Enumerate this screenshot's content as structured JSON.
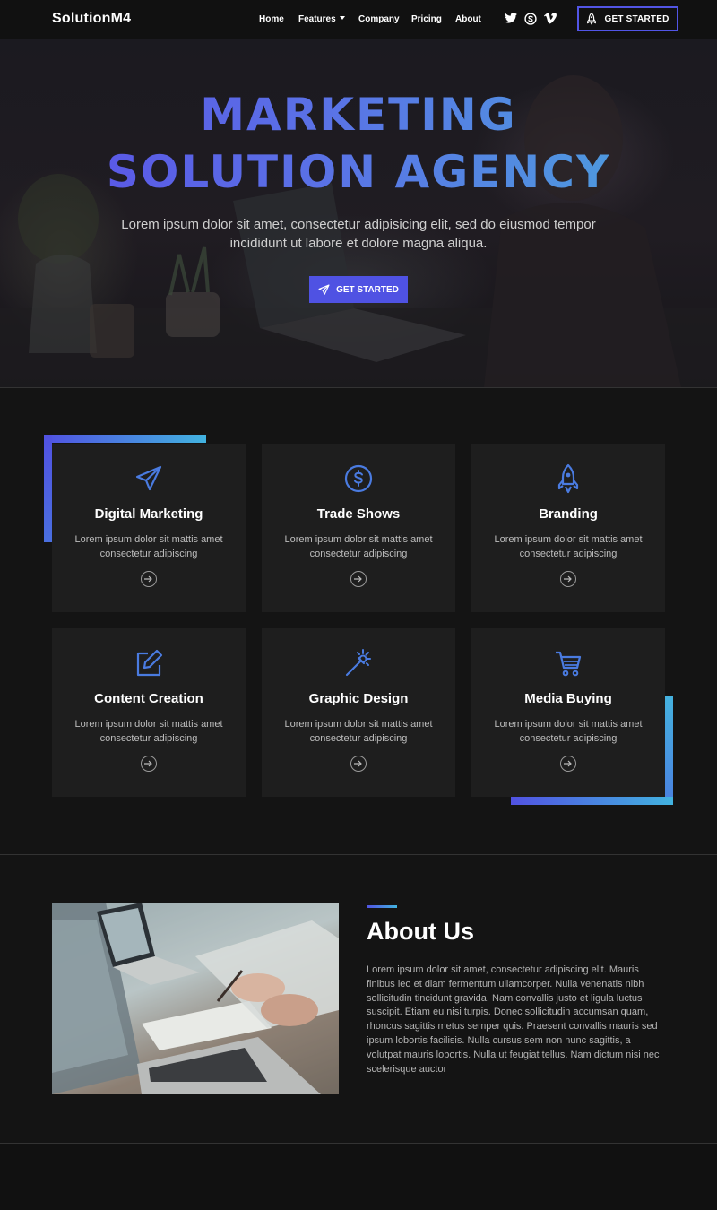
{
  "nav": {
    "logo": "SolutionM4",
    "links": [
      "Home",
      "Features",
      "Company",
      "Pricing",
      "About"
    ],
    "social_icons": [
      "twitter-icon",
      "skype-icon",
      "vimeo-icon"
    ],
    "cta_label": "GET STARTED"
  },
  "hero": {
    "title_line1": "MARKETING",
    "title_line2": "SOLUTION AGENCY",
    "subtitle_line1": "Lorem ipsum dolor sit amet, consectetur adipisicing elit, sed do eiusmod tempor",
    "subtitle_line2": "incididunt ut labore et dolore magna aliqua.",
    "button_label": "GET STARTED"
  },
  "services": {
    "cards": [
      {
        "title": "Digital Marketing",
        "text_line1": "Lorem ipsum dolor sit mattis amet",
        "text_line2": "consectetur adipiscing",
        "icon": "paper-plane-icon"
      },
      {
        "title": "Trade Shows",
        "text_line1": "Lorem ipsum dolor sit mattis amet",
        "text_line2": "consectetur adipiscing",
        "icon": "dollar-circle-icon"
      },
      {
        "title": "Branding",
        "text_line1": "Lorem ipsum dolor sit mattis amet",
        "text_line2": "consectetur adipiscing",
        "icon": "rocket-icon"
      },
      {
        "title": "Content Creation",
        "text_line1": "Lorem ipsum dolor sit mattis amet",
        "text_line2": "consectetur adipiscing",
        "icon": "edit-icon"
      },
      {
        "title": "Graphic Design",
        "text_line1": "Lorem ipsum dolor sit mattis amet",
        "text_line2": "consectetur adipiscing",
        "icon": "magic-wand-icon"
      },
      {
        "title": "Media Buying",
        "text_line1": "Lorem ipsum dolor sit mattis amet",
        "text_line2": "consectetur adipiscing",
        "icon": "shopping-cart-icon"
      }
    ]
  },
  "about": {
    "title": "About Us",
    "body": "Lorem ipsum dolor sit amet, consectetur adipiscing elit. Mauris finibus leo et diam fermentum ullamcorper. Nulla venenatis nibh sollicitudin tincidunt gravida. Nam convallis justo et ligula luctus suscipit. Etiam eu nisi turpis. Donec sollicitudin accumsan quam, rhoncus sagittis metus semper quis. Praesent convallis mauris sed ipsum lobortis facilisis. Nulla cursus sem non nunc sagittis, a volutpat mauris lobortis. Nulla ut feugiat tellus. Nam dictum nisi nec scelerisque auctor"
  },
  "colors": {
    "accent": "#4f52e3",
    "gradient_start": "#5152e2",
    "gradient_end": "#42b3e0",
    "icon_blue": "#4a7be0",
    "card_bg": "#1e1e1e",
    "page_bg": "#141414"
  }
}
